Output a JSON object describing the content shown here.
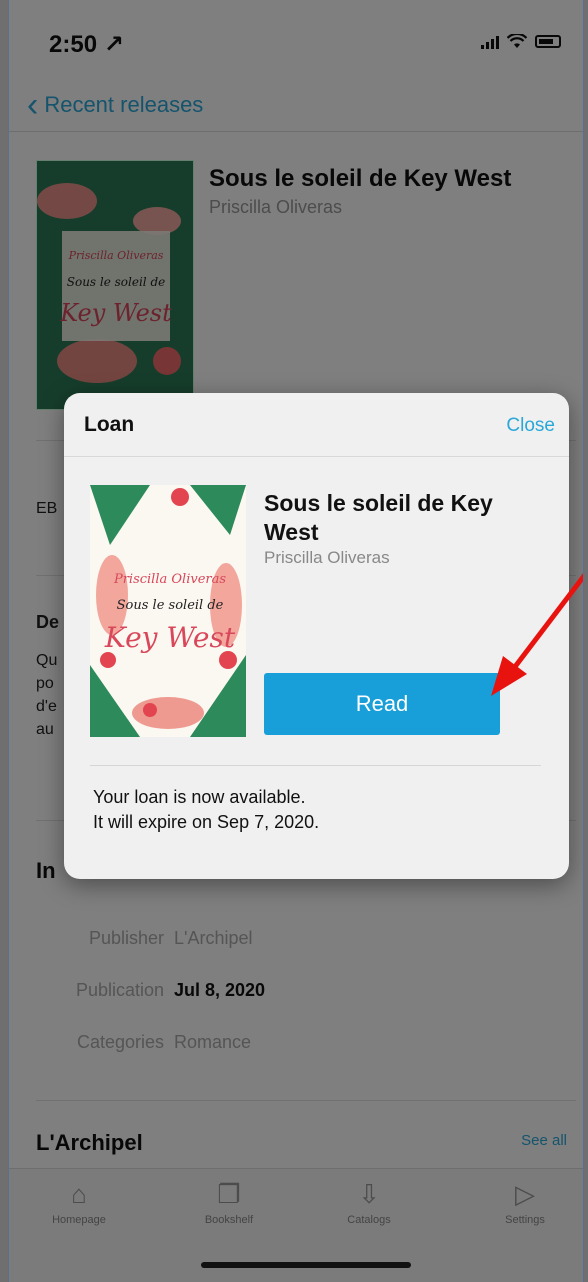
{
  "status_bar": {
    "time": "2:50 ↗"
  },
  "nav": {
    "back_label": "Recent releases"
  },
  "book": {
    "title": "Sous le soleil de Key West",
    "author": "Priscilla Oliveras",
    "cover_text_author": "Priscilla Oliveras",
    "cover_text_title1": "Sous le soleil de",
    "cover_text_title2": "Key West"
  },
  "background": {
    "format_fragment": "EB",
    "description_fragment": "De",
    "desc_lines": [
      "Qu",
      "po",
      "d'e",
      "au"
    ],
    "info_heading": "In",
    "info_rows": [
      {
        "label": "Publisher",
        "value": "L'Archipel"
      },
      {
        "label": "Publication",
        "value": "Jul 8, 2020"
      },
      {
        "label": "Categories",
        "value": "Romance"
      }
    ],
    "publisher_heading": "L'Archipel",
    "see_all": "See all"
  },
  "tabs": [
    {
      "label": "Homepage",
      "icon": "home-icon"
    },
    {
      "label": "Bookshelf",
      "icon": "book-icon"
    },
    {
      "label": "Catalogs",
      "icon": "download-icon"
    },
    {
      "label": "Settings",
      "icon": "play-icon"
    }
  ],
  "modal": {
    "title": "Loan",
    "close_label": "Close",
    "book_title": "Sous le soleil de Key West",
    "book_author": "Priscilla Oliveras",
    "read_label": "Read",
    "message_line1": "Your loan is now available.",
    "message_line2": "It will expire on Sep 7, 2020."
  },
  "colors": {
    "accent": "#189fd9",
    "link": "#2aa8d8",
    "arrow": "#e8130f"
  }
}
